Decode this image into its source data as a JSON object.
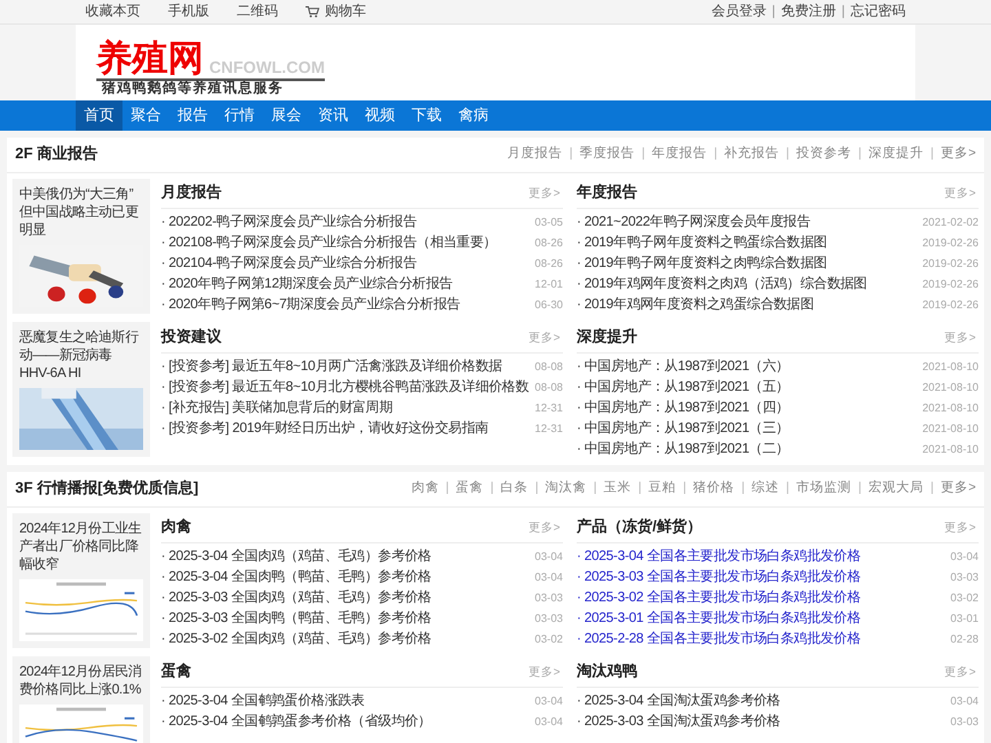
{
  "top_bar": {
    "left": [
      {
        "label": "收藏本页",
        "kind": "plain"
      },
      {
        "label": "手机版",
        "kind": "plain"
      },
      {
        "label": "二维码",
        "kind": "plain"
      },
      {
        "label": "购物车",
        "kind": "cart"
      }
    ],
    "right": [
      "会员登录",
      "免费注册",
      "忘记密码"
    ],
    "separator": "|"
  },
  "header": {
    "logo": "养殖网",
    "domain": "CNFOWL.COM",
    "slogan": "猪鸡鸭鹅鸽等养殖讯息服务"
  },
  "nav": [
    {
      "label": "首页",
      "selected": true
    },
    {
      "label": "聚合",
      "selected": false
    },
    {
      "label": "报告",
      "selected": false
    },
    {
      "label": "行情",
      "selected": false
    },
    {
      "label": "展会",
      "selected": false
    },
    {
      "label": "资讯",
      "selected": false
    },
    {
      "label": "视频",
      "selected": false
    },
    {
      "label": "下载",
      "selected": false
    },
    {
      "label": "禽病",
      "selected": false
    }
  ],
  "sections": [
    {
      "title": "2F 商业报告",
      "separator": "|",
      "links": [
        "月度报告",
        "季度报告",
        "年度报告",
        "补充报告",
        "投资参考",
        "深度提升",
        "更多>"
      ],
      "cards": [
        {
          "title": "中美俄仍为“大三角” 但中国战略主动已更明显",
          "kind": "picture"
        },
        {
          "title": "恶魔复生之哈迪斯行动——新冠病毒 HHV-6A HI",
          "kind": "picture"
        }
      ],
      "lists": [
        {
          "title": "月度报告",
          "more": "更多>",
          "highlighted": false,
          "items": [
            {
              "text": "· 202202-鸭子网深度会员产业综合分析报告",
              "date": "03-05"
            },
            {
              "text": "· 202108-鸭子网深度会员产业综合分析报告（相当重要）",
              "date": "08-26"
            },
            {
              "text": "· 202104-鸭子网深度会员产业综合分析报告",
              "date": "08-26"
            },
            {
              "text": "· 2020年鸭子网第12期深度会员产业综合分析报告",
              "date": "12-01"
            },
            {
              "text": "· 2020年鸭子网第6~7期深度会员产业综合分析报告",
              "date": "06-30"
            }
          ]
        },
        {
          "title": "年度报告",
          "more": "更多>",
          "highlighted": false,
          "items": [
            {
              "text": "· 2021~2022年鸭子网深度会员年度报告",
              "date": "2021-02-02"
            },
            {
              "text": "· 2019年鸭子网年度资料之鸭蛋综合数据图",
              "date": "2019-02-26"
            },
            {
              "text": "· 2019年鸭子网年度资料之肉鸭综合数据图",
              "date": "2019-02-26"
            },
            {
              "text": "· 2019年鸡网年度资料之肉鸡（活鸡）综合数据图",
              "date": "2019-02-26"
            },
            {
              "text": "· 2019年鸡网年度资料之鸡蛋综合数据图",
              "date": "2019-02-26"
            }
          ]
        },
        {
          "title": "投资建议",
          "more": "更多>",
          "highlighted": false,
          "items": [
            {
              "text": "· [投资参考] 最近五年8~10月两广活禽涨跌及详细价格数据",
              "date": "08-08"
            },
            {
              "text": "· [投资参考] 最近五年8~10月北方樱桃谷鸭苗涨跌及详细价格数",
              "date": "08-08"
            },
            {
              "text": "· [补充报告] 美联储加息背后的财富周期",
              "date": "12-31"
            },
            {
              "text": "· [投资参考] 2019年财经日历出炉，请收好这份交易指南",
              "date": "12-31"
            }
          ]
        },
        {
          "title": "深度提升",
          "more": "更多>",
          "highlighted": false,
          "items": [
            {
              "text": "· 中国房地产：从1987到2021（六）",
              "date": "2021-08-10"
            },
            {
              "text": "· 中国房地产：从1987到2021（五）",
              "date": "2021-08-10"
            },
            {
              "text": "· 中国房地产：从1987到2021（四）",
              "date": "2021-08-10"
            },
            {
              "text": "· 中国房地产：从1987到2021（三）",
              "date": "2021-08-10"
            },
            {
              "text": "· 中国房地产：从1987到2021（二）",
              "date": "2021-08-10"
            }
          ]
        }
      ]
    },
    {
      "title": "3F 行情播报[免费优质信息]",
      "separator": "|",
      "links": [
        "肉禽",
        "蛋禽",
        "白条",
        "淘汰禽",
        "玉米",
        "豆粕",
        "猪价格",
        "综述",
        "市场监测",
        "宏观大局",
        "更多>"
      ],
      "cards": [
        {
          "title": "2024年12月份工业生产者出厂价格同比降幅收窄",
          "kind": "picture"
        },
        {
          "title": "2024年12月份居民消费价格同比上涨0.1%",
          "kind": "picture"
        }
      ],
      "lists": [
        {
          "title": "肉禽",
          "more": "更多>",
          "highlighted": false,
          "items": [
            {
              "text": "· 2025-3-04 全国肉鸡（鸡苗、毛鸡）参考价格",
              "date": "03-04"
            },
            {
              "text": "· 2025-3-04 全国肉鸭（鸭苗、毛鸭）参考价格",
              "date": "03-04"
            },
            {
              "text": "· 2025-3-03 全国肉鸡（鸡苗、毛鸡）参考价格",
              "date": "03-03"
            },
            {
              "text": "· 2025-3-03 全国肉鸭（鸭苗、毛鸭）参考价格",
              "date": "03-03"
            },
            {
              "text": "· 2025-3-02 全国肉鸡（鸡苗、毛鸡）参考价格",
              "date": "03-02"
            }
          ]
        },
        {
          "title": "产品（冻货/鲜货）",
          "more": "更多>",
          "highlighted": true,
          "items": [
            {
              "text": "· 2025-3-04 全国各主要批发市场白条鸡批发价格",
              "date": "03-04"
            },
            {
              "text": "· 2025-3-03 全国各主要批发市场白条鸡批发价格",
              "date": "03-03"
            },
            {
              "text": "· 2025-3-02 全国各主要批发市场白条鸡批发价格",
              "date": "03-02"
            },
            {
              "text": "· 2025-3-01 全国各主要批发市场白条鸡批发价格",
              "date": "03-01"
            },
            {
              "text": "· 2025-2-28 全国各主要批发市场白条鸡批发价格",
              "date": "02-28"
            }
          ]
        },
        {
          "title": "蛋禽",
          "more": "更多>",
          "highlighted": false,
          "items": [
            {
              "text": "· 2025-3-04 全国鹌鹑蛋价格涨跌表",
              "date": "03-04"
            },
            {
              "text": "· 2025-3-04 全国鹌鹑蛋参考价格（省级均价）",
              "date": "03-04"
            }
          ]
        },
        {
          "title": "淘汰鸡鸭",
          "more": "更多>",
          "highlighted": false,
          "items": [
            {
              "text": "· 2025-3-04 全国淘汰蛋鸡参考价格",
              "date": "03-04"
            },
            {
              "text": "· 2025-3-03 全国淘汰蛋鸡参考价格",
              "date": "03-03"
            }
          ]
        }
      ]
    }
  ]
}
